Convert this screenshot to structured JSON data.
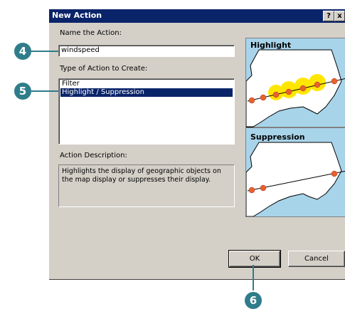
{
  "dialog": {
    "title": "New Action",
    "help_glyph": "?",
    "close_glyph": "x"
  },
  "form": {
    "name_label": "Name  the Action:",
    "name_value": "windspeed",
    "type_label": "Type of Action to Create:",
    "types": [
      "Filter",
      "Highlight / Suppression"
    ],
    "selected_type": "Highlight / Suppression",
    "description_label": "Action Description:",
    "description_text": "Highlights the display of geographic objects on the map display or suppresses their display."
  },
  "preview": {
    "highlight_label": "Highlight",
    "suppression_label": "Suppression"
  },
  "buttons": {
    "ok": "OK",
    "cancel": "Cancel"
  },
  "callouts": [
    "4",
    "5",
    "6"
  ],
  "colors": {
    "titlebar": "#0a246a",
    "callout": "#2f7d8a",
    "highlight": "#ffe600",
    "point": "#e8612c"
  }
}
